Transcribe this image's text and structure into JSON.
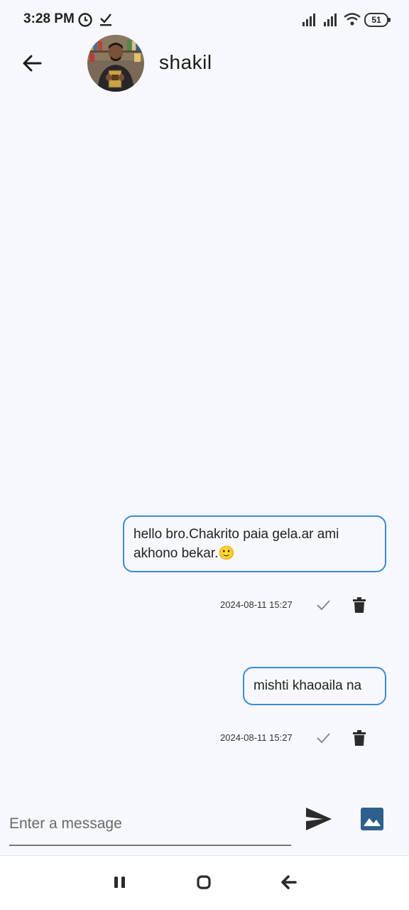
{
  "status_bar": {
    "time": "3:28 PM",
    "battery": "51",
    "icons": [
      "alarm-icon",
      "download-done-icon",
      "signal-icon",
      "signal-icon",
      "wifi-icon",
      "battery-icon"
    ]
  },
  "header": {
    "back_icon": "arrow-left-icon",
    "contact_name": "shakil"
  },
  "messages": [
    {
      "text": "hello bro.Chakrito paia gela.ar ami akhono bekar.🙂",
      "timestamp": "2024-08-11 15:27",
      "status_icon": "check-icon",
      "delete_icon": "trash-icon"
    },
    {
      "text": "mishti khaoaila na",
      "timestamp": "2024-08-11 15:27",
      "status_icon": "check-icon",
      "delete_icon": "trash-icon"
    }
  ],
  "composer": {
    "placeholder": "Enter a message",
    "value": "",
    "send_icon": "send-icon",
    "image_icon": "image-icon"
  },
  "nav_bar": {
    "icons": [
      "recents-icon",
      "home-icon",
      "back-icon"
    ]
  },
  "colors": {
    "background": "#f7f8fd",
    "bubble_border": "#3b8bd1",
    "image_button": "#2e5f8f"
  }
}
